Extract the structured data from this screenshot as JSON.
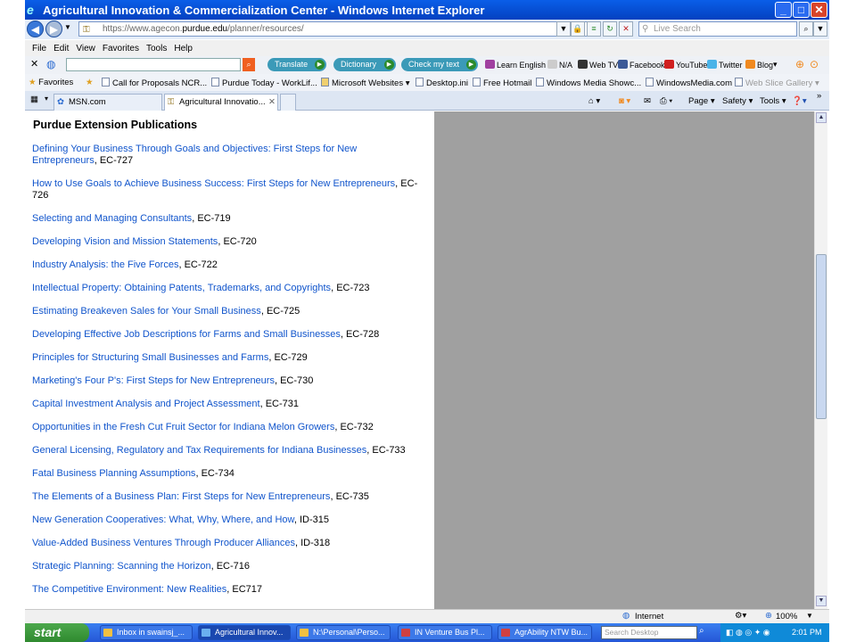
{
  "window": {
    "title": "Agricultural Innovation & Commercialization Center - Windows Internet Explorer"
  },
  "address": {
    "url_prefix": "https://www.agecon.",
    "url_domain": "purdue.edu",
    "url_suffix": "/planner/resources/",
    "search_placeholder": "Live Search"
  },
  "menu": {
    "items": [
      "File",
      "Edit",
      "View",
      "Favorites",
      "Tools",
      "Help"
    ]
  },
  "toolbar": {
    "translate": "Translate",
    "dictionary": "Dictionary",
    "check_text": "Check my text",
    "learn_english": "Learn English",
    "na": "N/A",
    "webtv": "Web TV",
    "facebook": "Facebook",
    "youtube": "YouTube",
    "twitter": "Twitter",
    "blog": "Blog"
  },
  "favorites": {
    "label": "Favorites",
    "items": [
      "Call for Proposals  NCR...",
      "Purdue Today - WorkLif...",
      "Microsoft Websites",
      "Desktop.ini",
      "Free Hotmail",
      "Windows Media Showc...",
      "WindowsMedia.com",
      "Web Slice Gallery"
    ]
  },
  "tabs": [
    {
      "label": "MSN.com"
    },
    {
      "label": "Agricultural Innovatio..."
    }
  ],
  "commands": {
    "page": "Page",
    "safety": "Safety",
    "tools": "Tools"
  },
  "content": {
    "heading": "Purdue Extension Publications",
    "publications": [
      {
        "title": "Defining Your Business Through Goals and Objectives: First Steps for New Entrepreneurs",
        "code": "EC-727"
      },
      {
        "title": "How to Use Goals to Achieve Business Success: First Steps for New Entrepreneurs",
        "code": "EC-726"
      },
      {
        "title": "Selecting and Managing Consultants",
        "code": "EC-719"
      },
      {
        "title": "Developing Vision and Mission Statements",
        "code": "EC-720"
      },
      {
        "title": "Industry Analysis: the Five Forces",
        "code": "EC-722"
      },
      {
        "title": "Intellectual Property: Obtaining Patents, Trademarks, and Copyrights",
        "code": "EC-723"
      },
      {
        "title": "Estimating Breakeven Sales for Your Small Business",
        "code": "EC-725"
      },
      {
        "title": "Developing Effective Job Descriptions for Farms and Small Businesses",
        "code": "EC-728"
      },
      {
        "title": "Principles for Structuring Small Businesses and Farms",
        "code": "EC-729"
      },
      {
        "title": "Marketing's Four P's: First Steps for New Entrepreneurs",
        "code": "EC-730"
      },
      {
        "title": "Capital Investment Analysis and Project Assessment",
        "code": "EC-731"
      },
      {
        "title": "Opportunities in the Fresh Cut Fruit Sector for Indiana Melon Growers",
        "code": "EC-732"
      },
      {
        "title": "General Licensing, Regulatory and Tax Requirements for Indiana Businesses",
        "code": "EC-733"
      },
      {
        "title": "Fatal Business Planning Assumptions",
        "code": "EC-734"
      },
      {
        "title": "The Elements of a Business Plan: First Steps for New Entrepreneurs",
        "code": "EC-735"
      },
      {
        "title": "New Generation Cooperatives: What, Why, Where, and How",
        "code": "ID-315"
      },
      {
        "title": "Value-Added Business Ventures Through Producer Alliances",
        "code": "ID-318"
      },
      {
        "title": "Strategic Planning: Scanning the Horizon",
        "code": "EC-716"
      },
      {
        "title": "The Competitive Environment: New Realities",
        "code": "EC717"
      }
    ]
  },
  "status": {
    "zone": "Internet",
    "zoom": "100%"
  },
  "taskbar": {
    "start": "start",
    "items": [
      "Inbox in swainsj_...",
      "Agricultural Innov...",
      "N:\\Personal\\Perso...",
      "IN Venture Bus Pl...",
      "AgrAbility NTW Bu..."
    ],
    "search_placeholder": "Search Desktop",
    "clock": "2:01 PM"
  }
}
